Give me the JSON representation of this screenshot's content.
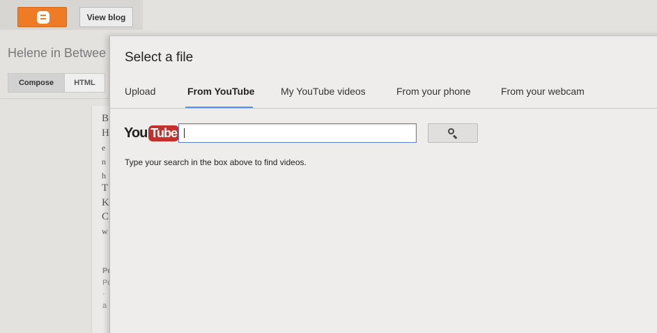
{
  "header": {
    "logo_icon": "blogger-logo-icon",
    "view_blog_label": "View blog"
  },
  "blog": {
    "title": "Helene in Betwee"
  },
  "editor_modes": {
    "compose_label": "Compose",
    "html_label": "HTML"
  },
  "editor_text": {
    "letters": [
      "B",
      "H",
      "e",
      "n",
      "h",
      "T",
      "K",
      "C",
      "w"
    ],
    "post_letters": [
      "Po",
      "Po",
      "·",
      "a"
    ]
  },
  "dialog": {
    "title": "Select a file",
    "tabs": [
      {
        "label": "Upload"
      },
      {
        "label": "From YouTube"
      },
      {
        "label": "My YouTube videos"
      },
      {
        "label": "From your phone"
      },
      {
        "label": "From your webcam"
      }
    ],
    "active_tab": "From YouTube",
    "youtube_logo": {
      "you": "You",
      "tube": "Tube"
    },
    "search": {
      "value": "",
      "placeholder": "",
      "button_icon": "search-icon"
    },
    "hint": "Type your search in the box above to find videos."
  },
  "colors": {
    "blogger_orange": "#ef7c24",
    "youtube_red": "#c4302b",
    "tab_underline": "#4d90fe",
    "input_border": "#5b7fc4"
  }
}
